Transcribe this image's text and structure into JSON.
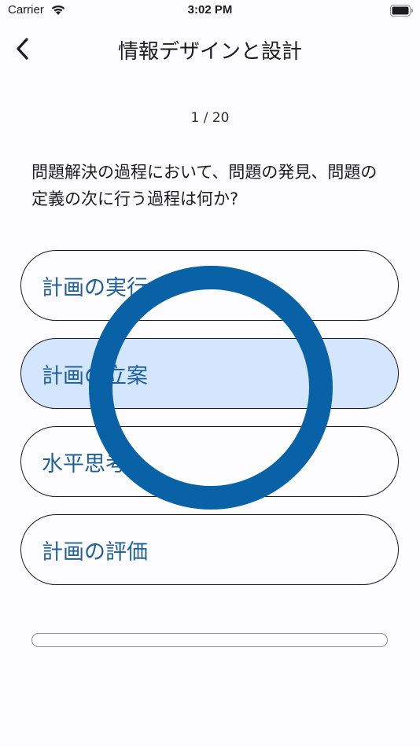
{
  "status_bar": {
    "carrier": "Carrier",
    "time": "3:02 PM",
    "wifi_icon": "wifi-icon",
    "battery_icon": "battery-full-icon"
  },
  "nav": {
    "back_icon": "chevron-left-icon",
    "title": "情報デザインと設計"
  },
  "progress": {
    "text": "1 / 20",
    "current": 1,
    "total": 20
  },
  "question": {
    "text": "問題解決の過程において、問題の発見、問題の定義の次に行う過程は何か?"
  },
  "options": [
    {
      "label": "計画の実行",
      "selected": false
    },
    {
      "label": "計画の立案",
      "selected": true
    },
    {
      "label": "水平思考",
      "selected": false
    },
    {
      "label": "計画の評価",
      "selected": false
    }
  ],
  "overlay": {
    "type": "loading-ring",
    "color": "#0962a6"
  },
  "colors": {
    "accent": "#1f5f9b",
    "selected_bg": "#d3e6fe",
    "ring": "#0962a6"
  }
}
